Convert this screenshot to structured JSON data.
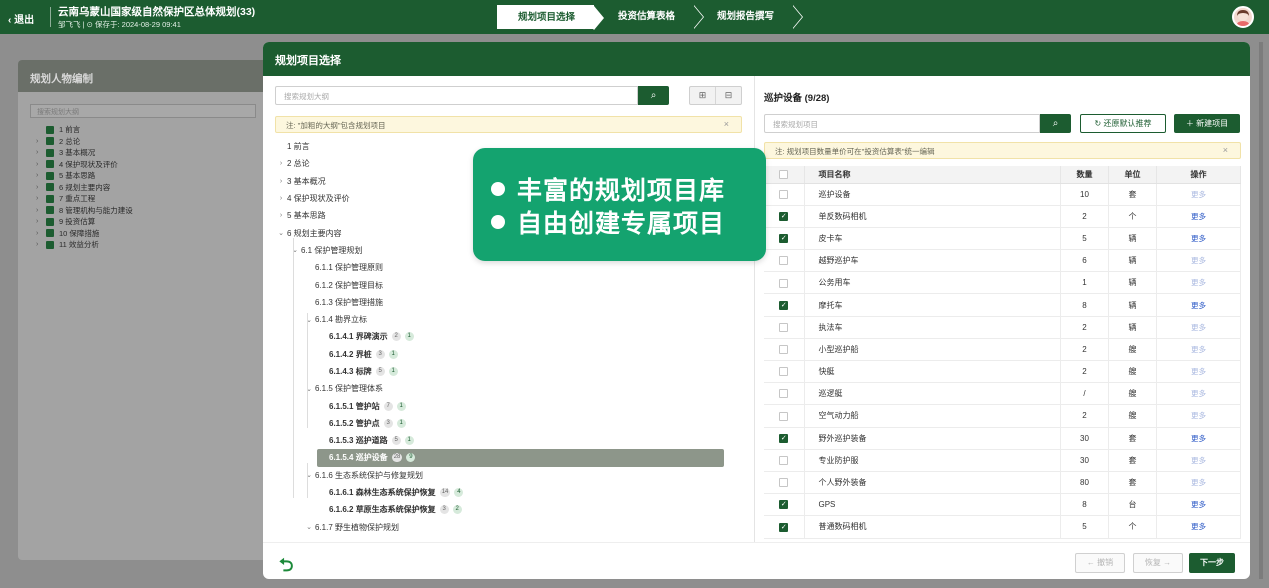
{
  "header": {
    "exit_label": "退出",
    "project_title": "云南乌蒙山国家级自然保护区总体规划(33)",
    "project_meta": "邹飞飞  |  ⊙ 保存于:  2024-08-29 09:41",
    "steps": [
      "规划项目选择",
      "投资估算表格",
      "规划报告撰写"
    ]
  },
  "background_panel": {
    "title": "规划人物编制",
    "search_placeholder": "搜索规划大纲",
    "items": [
      "1 前言",
      "2 总论",
      "3 基本概况",
      "4 保护现状及评价",
      "5 基本思路",
      "6 规划主要内容",
      "7 重点工程",
      "8 管理机构与能力建设",
      "9 投资估算",
      "10 保障措施",
      "11 效益分析"
    ]
  },
  "dialog": {
    "title": "规划项目选择",
    "left": {
      "search_placeholder": "搜索规划大纲",
      "note": "注: \"加粗的大纲\"包含规划项目",
      "tree": [
        {
          "label": "1 前言",
          "level": 0,
          "caret": ""
        },
        {
          "label": "2 总论",
          "level": 0,
          "caret": "›"
        },
        {
          "label": "3 基本概况",
          "level": 0,
          "caret": "›"
        },
        {
          "label": "4 保护现状及评价",
          "level": 0,
          "caret": "›"
        },
        {
          "label": "5 基本思路",
          "level": 0,
          "caret": "›"
        },
        {
          "label": "6 规划主要内容",
          "level": 0,
          "caret": "⌄"
        },
        {
          "label": "6.1 保护管理规划",
          "level": 1,
          "caret": "⌄"
        },
        {
          "label": "6.1.1 保护管理原则",
          "level": 2,
          "caret": ""
        },
        {
          "label": "6.1.2 保护管理目标",
          "level": 2,
          "caret": ""
        },
        {
          "label": "6.1.3 保护管理措施",
          "level": 2,
          "caret": ""
        },
        {
          "label": "6.1.4 勘界立标",
          "level": 2,
          "caret": "⌄"
        },
        {
          "label": "6.1.4.1 界碑演示",
          "level": 3,
          "caret": "",
          "bold": true,
          "c1": "2",
          "c2": "1"
        },
        {
          "label": "6.1.4.2 界桩",
          "level": 3,
          "caret": "",
          "bold": true,
          "c1": "3",
          "c2": "1"
        },
        {
          "label": "6.1.4.3 标牌",
          "level": 3,
          "caret": "",
          "bold": true,
          "c1": "5",
          "c2": "1"
        },
        {
          "label": "6.1.5 保护管理体系",
          "level": 2,
          "caret": "⌄"
        },
        {
          "label": "6.1.5.1 管护站",
          "level": 3,
          "caret": "",
          "bold": true,
          "c1": "7",
          "c2": "1"
        },
        {
          "label": "6.1.5.2 管护点",
          "level": 3,
          "caret": "",
          "bold": true,
          "c1": "3",
          "c2": "1"
        },
        {
          "label": "6.1.5.3 巡护道路",
          "level": 3,
          "caret": "",
          "bold": true,
          "c1": "5",
          "c2": "1"
        },
        {
          "label": "6.1.5.4 巡护设备",
          "level": 3,
          "caret": "",
          "bold": true,
          "c1": "28",
          "c2": "9",
          "selected": true
        },
        {
          "label": "6.1.6 生态系统保护与修复规划",
          "level": 2,
          "caret": "⌄"
        },
        {
          "label": "6.1.6.1 森林生态系统保护恢复",
          "level": 3,
          "caret": "",
          "bold": true,
          "c1": "14",
          "c2": "4"
        },
        {
          "label": "6.1.6.2 草原生态系统保护恢复",
          "level": 3,
          "caret": "",
          "bold": true,
          "c1": "3",
          "c2": "2"
        },
        {
          "label": "6.1.7 野生植物保护规划",
          "level": 2,
          "caret": "⌄"
        }
      ]
    },
    "right": {
      "title": "巡护设备  (9/28)",
      "search_placeholder": "搜索规划项目",
      "restore_label": "还原默认推荐",
      "new_label": "新建项目",
      "note": "注: 规划项目数量单价可在\"投资估算表\"统一编辑",
      "columns": [
        "项目名称",
        "数量",
        "单位",
        "操作"
      ],
      "rows": [
        {
          "name": "巡护设备",
          "qty": "10",
          "unit": "套",
          "checked": false,
          "op": "更多"
        },
        {
          "name": "单反数码相机",
          "qty": "2",
          "unit": "个",
          "checked": true,
          "op": "更多"
        },
        {
          "name": "皮卡车",
          "qty": "5",
          "unit": "辆",
          "checked": true,
          "op": "更多"
        },
        {
          "name": "越野巡护车",
          "qty": "6",
          "unit": "辆",
          "checked": false,
          "op": "更多"
        },
        {
          "name": "公务用车",
          "qty": "1",
          "unit": "辆",
          "checked": false,
          "op": "更多"
        },
        {
          "name": "摩托车",
          "qty": "8",
          "unit": "辆",
          "checked": true,
          "op": "更多"
        },
        {
          "name": "执法车",
          "qty": "2",
          "unit": "辆",
          "checked": false,
          "op": "更多"
        },
        {
          "name": "小型巡护船",
          "qty": "2",
          "unit": "艘",
          "checked": false,
          "op": "更多"
        },
        {
          "name": "快艇",
          "qty": "2",
          "unit": "艘",
          "checked": false,
          "op": "更多"
        },
        {
          "name": "巡逻艇",
          "qty": "/",
          "unit": "艘",
          "checked": false,
          "op": "更多"
        },
        {
          "name": "空气动力船",
          "qty": "2",
          "unit": "艘",
          "checked": false,
          "op": "更多"
        },
        {
          "name": "野外巡护装备",
          "qty": "30",
          "unit": "套",
          "checked": true,
          "op": "更多"
        },
        {
          "name": "专业防护服",
          "qty": "30",
          "unit": "套",
          "checked": false,
          "op": "更多"
        },
        {
          "name": "个人野外装备",
          "qty": "80",
          "unit": "套",
          "checked": false,
          "op": "更多"
        },
        {
          "name": "GPS",
          "qty": "8",
          "unit": "台",
          "checked": true,
          "op": "更多"
        },
        {
          "name": "普通数码相机",
          "qty": "5",
          "unit": "个",
          "checked": true,
          "op": "更多"
        }
      ]
    },
    "footer": {
      "undo_label": "撤销",
      "redo_label": "恢复",
      "next_label": "下一步"
    }
  },
  "promo": {
    "lines": [
      "丰富的规划项目库",
      "自由创建专属项目"
    ]
  },
  "colors": {
    "brand": "#1c5c30",
    "promo": "#14a36f",
    "link": "#2b58c6"
  }
}
